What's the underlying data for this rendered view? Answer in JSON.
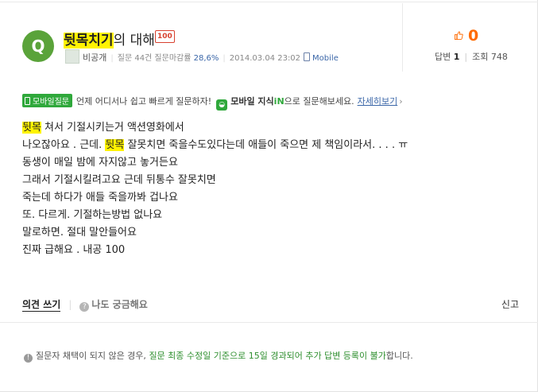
{
  "question": {
    "badge": "Q",
    "title_highlight": "뒷목치기",
    "title_rest": "의 대해",
    "points_badge": "100"
  },
  "meta": {
    "author": "비공개",
    "stats_prefix": "질문 44건 질문마감률",
    "close_rate": "28,6%",
    "datetime": "2014.03.04 23:02",
    "source": "Mobile"
  },
  "stats": {
    "likes": "0",
    "answers_label": "답변",
    "answers": "1",
    "views_label": "조회",
    "views": "748"
  },
  "mobile_banner": {
    "badge": "모바일질문",
    "text": "언제 어디서나 쉽고 빠르게 질문하자!",
    "app_prefix": "모바일",
    "app_name": "지식",
    "app_in": "iN",
    "app_suffix": "으로 질문해보세요.",
    "detail_link": "자세히보기"
  },
  "body": {
    "line1_hl": "뒷목",
    "line1_rest": " 쳐서 기절시키는거 액션영화에서",
    "line2_a": "나오잖아요 . 근데.",
    "line2_hl": "뒷목",
    "line2_b": " 잘못치면 죽을수도있다는데 애들이 죽으면 제 책임이라서. . . . ㅠ",
    "line3": "동생이 매일 밤에 자지않고 놓거든요",
    "line4": "그래서 기절시킬려고요 근데 뒤통수 잘못치면",
    "line5": "죽는데 하다가 애들 죽을까봐 겁나요",
    "line6": "또. 다르게. 기절하는방법 없나요",
    "line7": "말로하면. 절대 말안들어요",
    "line8": "진짜 급해요 . 내공 100"
  },
  "actions": {
    "opinion": "의견 쓰기",
    "curious": "나도 궁금해요",
    "report": "신고"
  },
  "notice": {
    "prefix": "질문자 채택이 되지 않은 경우,",
    "green": "질문 최종 수정일 기준으로 15일 경과되어 추가 답변 등록이 불가",
    "suffix": "합니다."
  },
  "colors": {
    "accent_green": "#5aa33a",
    "highlight": "#fff300",
    "likes_orange": "#ff6a00",
    "link_blue": "#3a66a8"
  }
}
